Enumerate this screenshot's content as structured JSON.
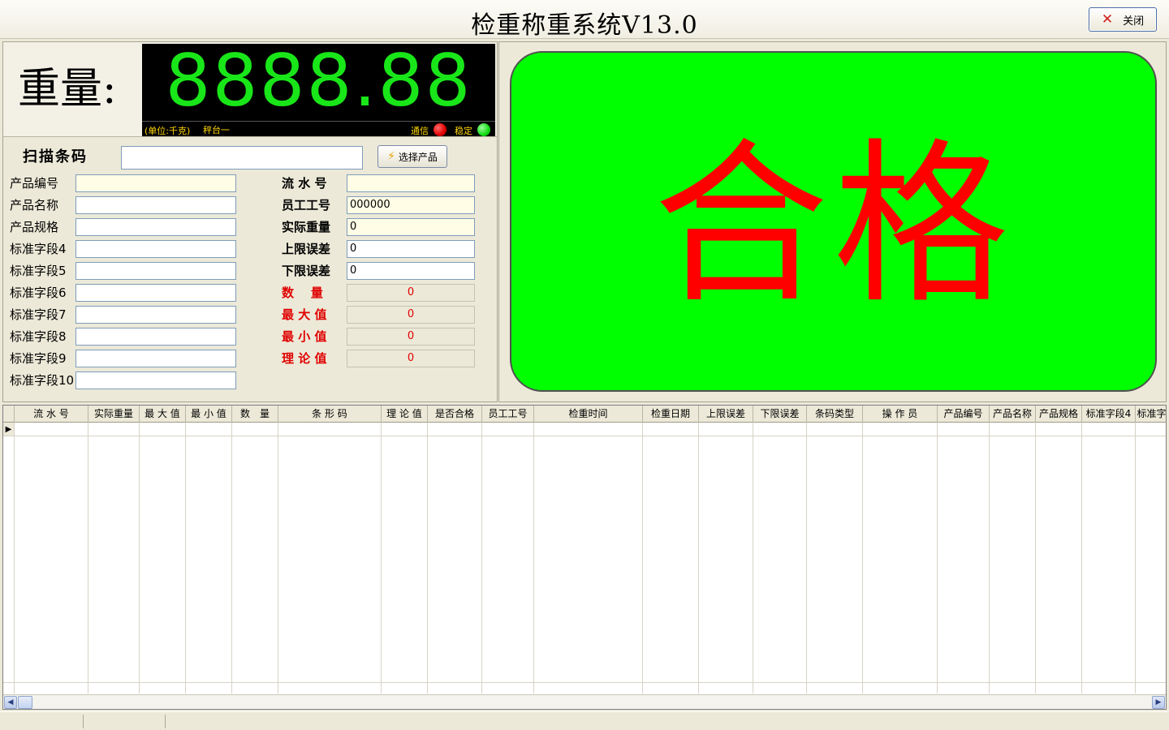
{
  "window": {
    "title": "检重称重系统V13.0",
    "close_label": "关闭"
  },
  "scale": {
    "weight_label": "重量:",
    "display_value": "8888.88",
    "unit_text": "(单位:千克)",
    "scale_name": "秤台一",
    "comm_label": "通信",
    "comm_status_color": "#e00000",
    "stable_label": "稳定",
    "stable_status_color": "#12d912"
  },
  "scan": {
    "label": "扫描条码",
    "value": "",
    "select_button": "选择产品"
  },
  "left_fields": [
    {
      "label": "产品编号",
      "value": ""
    },
    {
      "label": "产品名称",
      "value": ""
    },
    {
      "label": "产品规格",
      "value": ""
    },
    {
      "label": "标准字段4",
      "value": ""
    },
    {
      "label": "标准字段5",
      "value": ""
    },
    {
      "label": "标准字段6",
      "value": ""
    },
    {
      "label": "标准字段7",
      "value": ""
    },
    {
      "label": "标准字段8",
      "value": ""
    },
    {
      "label": "标准字段9",
      "value": ""
    },
    {
      "label": "标准字段10",
      "value": ""
    }
  ],
  "right_fields": [
    {
      "label": "流 水 号",
      "value": ""
    },
    {
      "label": "员工工号",
      "value": "000000"
    },
    {
      "label": "实际重量",
      "value": "0"
    },
    {
      "label": "上限误差",
      "value": "0"
    },
    {
      "label": "下限误差",
      "value": "0"
    }
  ],
  "stats": [
    {
      "label": "数    量",
      "value": "0"
    },
    {
      "label": "最 大 值",
      "value": "0"
    },
    {
      "label": "最 小 值",
      "value": "0"
    },
    {
      "label": "理 论 值",
      "value": "0"
    }
  ],
  "result": {
    "text": "合格",
    "background": "#00ff00",
    "text_color": "#ff0000"
  },
  "table": {
    "columns": [
      "流 水 号",
      "实际重量",
      "最 大 值",
      "最 小 值",
      "数　量",
      "条 形 码",
      "理 论 值",
      "是否合格",
      "员工工号",
      "检重时间",
      "检重日期",
      "上限误差",
      "下限误差",
      "条码类型",
      "操 作 员",
      "产品编号",
      "产品名称",
      "产品规格",
      "标准字段4",
      "标准字"
    ],
    "rows": []
  }
}
